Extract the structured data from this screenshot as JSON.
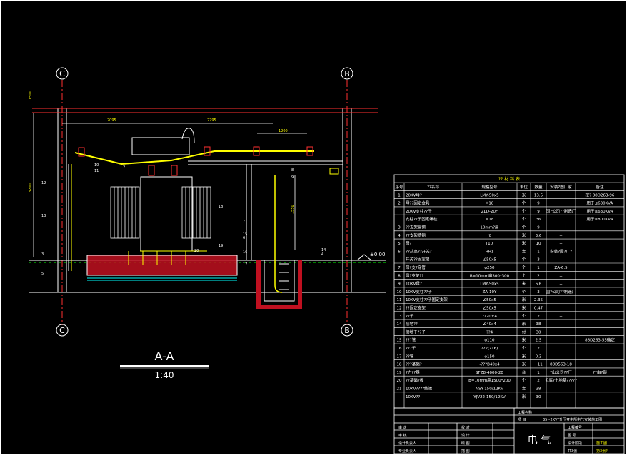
{
  "axes": {
    "left": "C",
    "right": "B"
  },
  "section": {
    "title": "A-A",
    "scale": "1:40"
  },
  "level": "±0.00",
  "dims": [
    "2095",
    "2795",
    "1200",
    "3200",
    "1550",
    "1500"
  ],
  "callouts": [
    "1",
    "2",
    "3",
    "4",
    "5",
    "6",
    "7",
    "8",
    "9",
    "10",
    "11",
    "12",
    "13",
    "14",
    "15",
    "16",
    "17",
    "18",
    "19",
    "20"
  ],
  "table": {
    "title": "?? 材 料 表",
    "headers": [
      "序号",
      "??名称",
      "规格型号",
      "单位",
      "数量",
      "安装?图厂家",
      "备注"
    ],
    "rows": [
      [
        "1",
        "20KV母?",
        "LMY-50x5",
        "米",
        "13.5",
        "",
        "按? 88D263-96"
      ],
      [
        "2",
        "母??固定金具",
        "M18",
        "个",
        "9",
        "",
        "用于≤630KVA"
      ],
      [
        "",
        "20KV支柱??子",
        "ZLD-20F",
        "个",
        "9",
        "国?公司??制造厂",
        "用于≤630KVA"
      ],
      [
        "",
        "支柱??子固定螺栓",
        "M18",
        "个",
        "36",
        "",
        "用于≥800KVA"
      ],
      [
        "3",
        "??支架扁钢",
        "10mm?扁",
        "个",
        "9",
        "",
        ""
      ],
      [
        "4",
        "??支架槽钢",
        "[8",
        "米",
        "3.6",
        "--",
        ""
      ],
      [
        "5",
        "母?",
        "[10",
        "米",
        "10",
        "--",
        ""
      ],
      [
        "6",
        "??式高??开关?",
        "HH1",
        "套",
        "1",
        "安装?图?厂?",
        ""
      ],
      [
        "",
        "开关??固定架",
        "∠50x5",
        "个",
        "3",
        "",
        ""
      ],
      [
        "7",
        "母?支?穿管",
        "φ250",
        "个",
        "1",
        "ZA-6.5",
        ""
      ],
      [
        "8",
        "母?支架??",
        "B=10mm扁300*300",
        "个",
        "2",
        "--",
        ""
      ],
      [
        "9",
        "10KV母?",
        "LMY-50x5",
        "米",
        "6.6",
        "--",
        ""
      ],
      [
        "10",
        "10KV支柱??子",
        "ZA-10Y",
        "个",
        "3",
        "国?公司??制造厂",
        ""
      ],
      [
        "11",
        "10KV支柱??子固定支架",
        "∠50x5",
        "米",
        "2.35",
        "",
        ""
      ],
      [
        "12",
        "??固定支架",
        "∠50x5",
        "米",
        "0.47",
        "",
        ""
      ],
      [
        "13",
        "??子",
        "??20×4",
        "个",
        "2",
        "--",
        ""
      ],
      [
        "14",
        "接地??",
        "∠40x4",
        "米",
        "38",
        "--",
        ""
      ],
      [
        "",
        "接地干??子",
        "??4",
        "付",
        "30",
        "",
        ""
      ],
      [
        "15",
        "???管",
        "φ110",
        "米",
        "2.5",
        "",
        "88D263-55确定"
      ],
      [
        "16",
        "???子",
        "??2(?16)",
        "个",
        "2",
        "",
        ""
      ],
      [
        "17",
        "??管",
        "φ150",
        "米",
        "0.3",
        "",
        ""
      ],
      [
        "18",
        "???基础?",
        "-???B40x4",
        "米",
        "~11",
        "88D563-18",
        ""
      ],
      [
        "19",
        "?力??器",
        "SFZ8-4000-20",
        "台",
        "1",
        "?山公司??厂",
        "??由?部"
      ],
      [
        "20",
        "??基础?板",
        "B=10mm扁1500*200",
        "个",
        "2",
        "见底?土地基?????",
        ""
      ],
      [
        "21",
        "10KV????终端",
        "NSY-150/12KV",
        "套",
        "38",
        "--",
        ""
      ],
      [
        "",
        "10KV??",
        "YJV22-150/12KV",
        "米",
        "30",
        "",
        ""
      ]
    ]
  },
  "titleblock": {
    "project_label": "工程名称",
    "item_label": "项 目",
    "item_value": "35~2KV?升压变电所电气安装施工图",
    "roles_left": [
      "审 定",
      "审 核",
      "设计负责人",
      "专业负责人"
    ],
    "roles_right": [
      "校 对",
      "设 计",
      "绘 图",
      "描 图"
    ],
    "discipline": "电 气",
    "right_labels": [
      "工程编号",
      "图 号",
      "设计阶段",
      "共3张"
    ],
    "right_values": [
      "",
      "",
      "施工图",
      "第3张?"
    ]
  }
}
